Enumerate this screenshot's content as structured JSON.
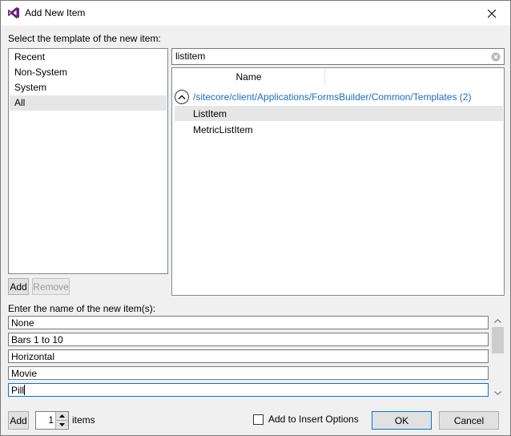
{
  "window": {
    "title": "Add New Item"
  },
  "labels": {
    "select_template": "Select the template of the new item:",
    "enter_name": "Enter the name of the new item(s):",
    "items_suffix": "items",
    "add_insert_options": "Add to Insert Options"
  },
  "categories": [
    "Recent",
    "Non-System",
    "System",
    "All"
  ],
  "selected_category": "All",
  "left_buttons": {
    "add": "Add",
    "remove": "Remove"
  },
  "search": {
    "value": "listitem"
  },
  "results": {
    "column_name": "Name",
    "folder_path": "/sitecore/client/Applications/FormsBuilder/Common/Templates (2)",
    "items": [
      "ListItem",
      "MetricListItem"
    ],
    "selected": "ListItem"
  },
  "item_names": [
    "None",
    "Bars 1 to 10",
    "Horizontal",
    "Movie",
    "Pill"
  ],
  "bottom": {
    "add": "Add",
    "count": "1",
    "add_to_insert_options_checked": false,
    "ok": "OK",
    "cancel": "Cancel"
  },
  "colors": {
    "link": "#1e6dc2",
    "accent": "#0078d7",
    "vs_purple": "#68217a"
  },
  "icons": [
    "visual-studio-icon",
    "close-icon",
    "clear-search-icon",
    "collapse-icon",
    "scroll-up-icon",
    "scroll-down-icon",
    "stepper-up-icon",
    "stepper-down-icon"
  ]
}
